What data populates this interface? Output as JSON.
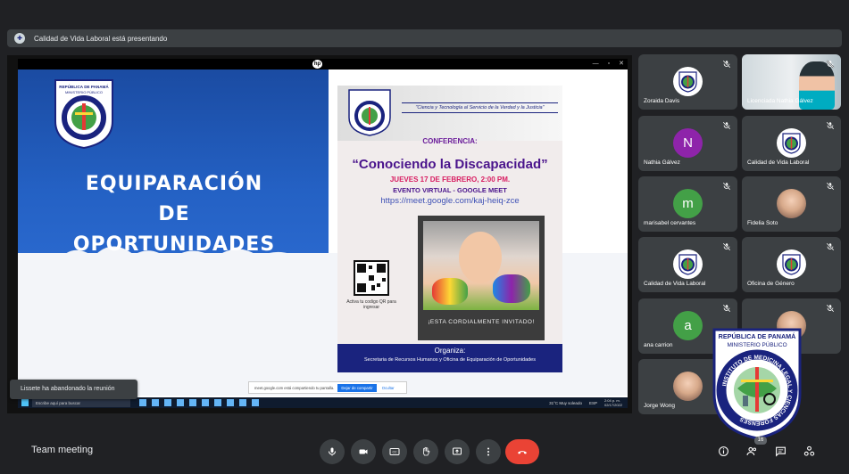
{
  "presenting": {
    "text": "Calidad de Vida Laboral está presentando"
  },
  "slide": {
    "logo_text_top": "REPÚBLICA DE PANAMÁ",
    "logo_text_sub": "MINISTERIO PÚBLICO",
    "title_lines": [
      "EQUIPARACIÓN",
      "DE",
      "OPORTUNIDADES"
    ],
    "poster": {
      "tagline": "\"Ciencia y Tecnología al Servicio de la Verdad y la Justicia\"",
      "conference": "CONFERENCIA:",
      "title": "“Conociendo la Discapacidad”",
      "date": "JUEVES 17 DE FEBRERO, 2:00 PM.",
      "event": "EVENTO VIRTUAL - GOOGLE MEET",
      "url": "https://meet.google.com/kaj-heiq-zce",
      "invite": "¡ESTA CORDIALMENTE INVITADO!",
      "qr_text": "Activa tu codigo QR para ingresar",
      "org_title": "Organiza:",
      "org_text": "Secretaria de Recursos Humanos y Oficina de Equiparación de Oportunidades"
    },
    "share_notice": {
      "text": "meet.google.com está compartiendo tu pantalla.",
      "stop": "Dejar de compartir",
      "hide": "Ocultar"
    },
    "taskbar": {
      "search": "Escribe aquí para buscar",
      "weather": "31°C  Muy soleado",
      "lang": "ESP",
      "time": "2:04 p. m.",
      "date": "02/17/2022"
    }
  },
  "toast": {
    "text": "Lissete ha abandonado la reunión"
  },
  "participants": [
    {
      "name": "Zoraida Davis",
      "avatar": "logo"
    },
    {
      "name": "Licenciada Nathia Gálvez",
      "avatar": "camera"
    },
    {
      "name": "Nathia Gálvez",
      "avatar": "letter",
      "letter": "N",
      "color": "#8e24aa"
    },
    {
      "name": "Calidad de Vida Laboral",
      "avatar": "logo"
    },
    {
      "name": "marisabel cervantes",
      "avatar": "letter",
      "letter": "m",
      "color": "#43a047"
    },
    {
      "name": "Fidelia Soto",
      "avatar": "photo"
    },
    {
      "name": "Calidad de Vida Laboral",
      "avatar": "logo"
    },
    {
      "name": "Oficina de Género",
      "avatar": "logo"
    },
    {
      "name": "ana carrion",
      "avatar": "letter",
      "letter": "a",
      "color": "#43a047"
    },
    {
      "name": "",
      "avatar": "photo"
    },
    {
      "name": "Jorge Wong",
      "avatar": "photo"
    }
  ],
  "overlay_logo": {
    "top": "REPÚBLICA DE PANAMÁ",
    "sub": "MINISTERIO PÚBLICO",
    "ring": "INSTITUTO DE MEDICINA LEGAL Y CIENCIAS FORENSES"
  },
  "meeting": {
    "name": "Team meeting",
    "participant_count": "16"
  },
  "colors": {
    "background": "#202124",
    "tile": "#3c4043",
    "end_call": "#ea4335",
    "accent": "#1a73e8"
  }
}
